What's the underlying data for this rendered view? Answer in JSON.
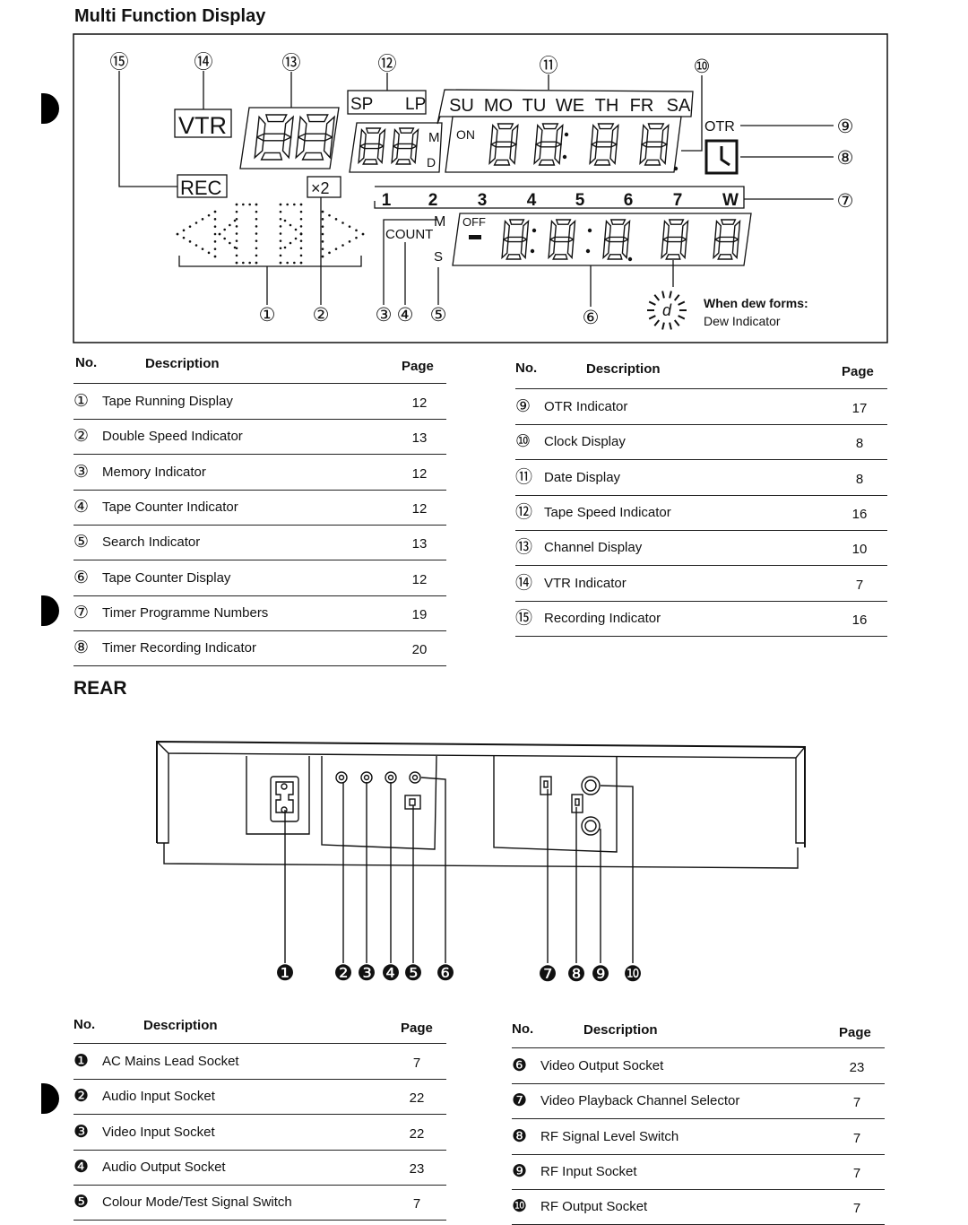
{
  "display_section": {
    "title": "Multi Function Display",
    "callouts": [
      "①",
      "②",
      "③",
      "④",
      "⑤",
      "⑥",
      "⑦",
      "⑧",
      "⑨",
      "⑩",
      "⑪",
      "⑫",
      "⑬",
      "⑭",
      "⑮"
    ],
    "labels": {
      "vtr": "VTR",
      "rec": "REC",
      "x2": "×2",
      "sp": "SP",
      "lp": "LP",
      "m": "M",
      "d": "D",
      "on": "ON",
      "off": "OFF",
      "count": "COUNT",
      "s": "S",
      "otr": "OTR",
      "days": [
        "SU",
        "MO",
        "TU",
        "WE",
        "TH",
        "FR",
        "SA"
      ],
      "programmes": [
        "1",
        "2",
        "3",
        "4",
        "5",
        "6",
        "7",
        "W"
      ],
      "dew_title": "When dew forms:",
      "dew_label": "Dew Indicator",
      "dew_glyph": "d"
    },
    "table_headers": {
      "no": "No.",
      "description": "Description",
      "page": "Page"
    },
    "items": [
      {
        "no": "①",
        "description": "Tape Running Display",
        "page": "12"
      },
      {
        "no": "②",
        "description": "Double Speed Indicator",
        "page": "13"
      },
      {
        "no": "③",
        "description": "Memory Indicator",
        "page": "12"
      },
      {
        "no": "④",
        "description": "Tape Counter Indicator",
        "page": "12"
      },
      {
        "no": "⑤",
        "description": "Search Indicator",
        "page": "13"
      },
      {
        "no": "⑥",
        "description": "Tape Counter Display",
        "page": "12"
      },
      {
        "no": "⑦",
        "description": "Timer Programme Numbers",
        "page": "19"
      },
      {
        "no": "⑧",
        "description": "Timer Recording Indicator",
        "page": "20"
      },
      {
        "no": "⑨",
        "description": "OTR Indicator",
        "page": "17"
      },
      {
        "no": "⑩",
        "description": "Clock Display",
        "page": "8"
      },
      {
        "no": "⑪",
        "description": "Date Display",
        "page": "8"
      },
      {
        "no": "⑫",
        "description": "Tape Speed Indicator",
        "page": "16"
      },
      {
        "no": "⑬",
        "description": "Channel Display",
        "page": "10"
      },
      {
        "no": "⑭",
        "description": "VTR Indicator",
        "page": "7"
      },
      {
        "no": "⑮",
        "description": "Recording Indicator",
        "page": "16"
      }
    ]
  },
  "rear_section": {
    "title": "REAR",
    "callouts": [
      "❶",
      "❷",
      "❸",
      "❹",
      "❺",
      "❻",
      "❼",
      "❽",
      "❾",
      "❿"
    ],
    "table_headers": {
      "no": "No.",
      "description": "Description",
      "page": "Page"
    },
    "items": [
      {
        "no": "❶",
        "description": "AC Mains Lead Socket",
        "page": "7"
      },
      {
        "no": "❷",
        "description": "Audio Input Socket",
        "page": "22"
      },
      {
        "no": "❸",
        "description": "Video Input Socket",
        "page": "22"
      },
      {
        "no": "❹",
        "description": "Audio Output Socket",
        "page": "23"
      },
      {
        "no": "❺",
        "description": "Colour Mode/Test Signal Switch",
        "page": "7"
      },
      {
        "no": "❻",
        "description": "Video Output Socket",
        "page": "23"
      },
      {
        "no": "❼",
        "description": "Video Playback Channel Selector",
        "page": "7"
      },
      {
        "no": "❽",
        "description": "RF Signal Level Switch",
        "page": "7"
      },
      {
        "no": "❾",
        "description": "RF Input Socket",
        "page": "7"
      },
      {
        "no": "❿",
        "description": "RF Output Socket",
        "page": "7"
      }
    ]
  }
}
